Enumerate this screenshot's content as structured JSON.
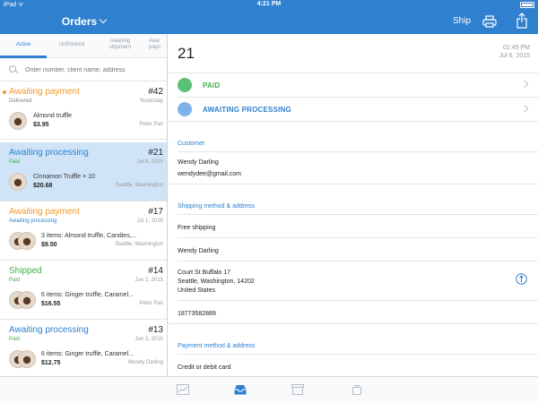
{
  "status_bar": {
    "left": "iPad ᯤ",
    "time": "4:21 PM",
    "battery": ""
  },
  "nav": {
    "title": "Orders",
    "ship_label": "Ship",
    "print_icon": "printer-icon",
    "share_icon": "share-icon"
  },
  "tabs": [
    {
      "label": "Active",
      "active": true
    },
    {
      "label": "Unfinished",
      "active": false
    },
    {
      "label": "Awaiting\nshipment",
      "active": false
    },
    {
      "label": "Awa\npayn",
      "active": false
    }
  ],
  "search": {
    "placeholder": "Order number, client name, address"
  },
  "orders": [
    {
      "status": "Awaiting payment",
      "status_color": "orange",
      "number": "#42",
      "sub": "Delivered",
      "sub_color": "gray",
      "date": "Yesterday",
      "item": "Almond truffle",
      "price": "$3.95",
      "who": "Peter Pan",
      "thumbs": 1,
      "unread": true
    },
    {
      "status": "Awaiting processing",
      "status_color": "blue",
      "number": "#21",
      "sub": "Paid",
      "sub_color": "green",
      "date": "Jul 6, 2015",
      "item": "Cinnamon Truffle × 10",
      "price": "$20.68",
      "who": "Seattle, Washington",
      "thumbs": 1,
      "selected": true
    },
    {
      "status": "Awaiting payment",
      "status_color": "orange",
      "number": "#17",
      "sub": "Awaiting processing",
      "sub_color": "blue",
      "date": "Jul 1, 2015",
      "item": "3 items: Almond truffle, Candies,...",
      "price": "$9.50",
      "who": "Seattle, Washington",
      "thumbs": 2
    },
    {
      "status": "Shipped",
      "status_color": "green",
      "number": "#14",
      "sub": "Paid",
      "sub_color": "green",
      "date": "Jun 2, 2015",
      "item": "6 items: Ginger truffle, Caramel...",
      "price": "$16.55",
      "who": "Peter Pan",
      "thumbs": 2
    },
    {
      "status": "Awaiting processing",
      "status_color": "blue",
      "number": "#13",
      "sub": "Paid",
      "sub_color": "green",
      "date": "Jun 3, 2015",
      "item": "6 items: Ginger truffle, Caramel...",
      "price": "$12.75",
      "who": "Wendy Darling",
      "thumbs": 2
    }
  ],
  "detail": {
    "order_number": "21",
    "time": "01:45 PM",
    "date": "Jul 6, 2015",
    "payment_state": {
      "label": "PAID",
      "color": "#3fb24a",
      "circle": "#5bbf76"
    },
    "fulfillment_state": {
      "label": "AWAITING PROCESSING",
      "color": "#2f80cf",
      "circle": "#7fb3e8"
    },
    "customer_heading": "Customer",
    "customer_name": "Wendy Darling",
    "customer_email": "wendydee@gmail.com",
    "shipping_heading": "Shipping method & address",
    "shipping_method": "Free shipping",
    "ship_name": "Wendy Darling",
    "address_line1": "Court St Buffalo 17",
    "address_line2": "Seattle, Washington, 14202",
    "address_line3": "United States",
    "phone": "18773582889",
    "payment_heading": "Payment method & address",
    "payment_method": "Credit or debit card"
  },
  "tabbar": [
    {
      "icon": "stats-icon",
      "active": false
    },
    {
      "icon": "orders-tray-icon",
      "active": true
    },
    {
      "icon": "catalog-box-icon",
      "active": false
    },
    {
      "icon": "store-bag-icon",
      "active": false
    }
  ]
}
